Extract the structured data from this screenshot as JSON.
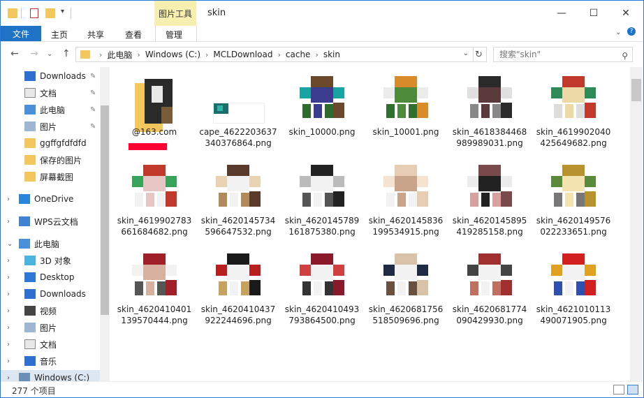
{
  "window": {
    "title": "skin",
    "context_tab": "图片工具",
    "close_glyph": "✕",
    "maximize_glyph": "☐",
    "minimize_glyph": "—"
  },
  "ribbon": {
    "file": "文件",
    "tabs": [
      "主页",
      "共享",
      "查看"
    ],
    "manage": "管理"
  },
  "address": {
    "crumbs": [
      "此电脑",
      "Windows (C:)",
      "MCLDownload",
      "cache",
      "skin"
    ],
    "search_placeholder": "搜索\"skin\""
  },
  "nav": {
    "items": [
      {
        "label": "Downloads",
        "icon": "download-arrow-icon",
        "pinned": true
      },
      {
        "label": "文档",
        "icon": "document-icon",
        "pinned": true
      },
      {
        "label": "此电脑",
        "icon": "computer-icon",
        "pinned": true
      },
      {
        "label": "图片",
        "icon": "pictures-icon",
        "pinned": true
      },
      {
        "label": "ggffgfdfdfd",
        "icon": "folder-icon",
        "pinned": false
      },
      {
        "label": "保存的图片",
        "icon": "folder-icon",
        "pinned": false
      },
      {
        "label": "屏幕截图",
        "icon": "folder-icon",
        "pinned": false
      },
      {
        "label": "OneDrive",
        "icon": "cloud-icon",
        "pinned": false
      },
      {
        "label": "WPS云文档",
        "icon": "wps-cloud-icon",
        "pinned": false
      },
      {
        "label": "此电脑",
        "icon": "computer-icon",
        "pinned": false
      },
      {
        "label": "3D 对象",
        "icon": "cube-icon",
        "pinned": false
      },
      {
        "label": "Desktop",
        "icon": "desktop-icon",
        "pinned": false
      },
      {
        "label": "Downloads",
        "icon": "download-arrow-icon",
        "pinned": false
      },
      {
        "label": "视频",
        "icon": "video-icon",
        "pinned": false
      },
      {
        "label": "图片",
        "icon": "pictures-icon",
        "pinned": false
      },
      {
        "label": "文档",
        "icon": "document-icon",
        "pinned": false
      },
      {
        "label": "音乐",
        "icon": "music-icon",
        "pinned": false
      },
      {
        "label": "Windows (C:)",
        "icon": "drive-icon",
        "pinned": false
      }
    ]
  },
  "files": [
    {
      "name": "@163.com"
    },
    {
      "name": "cape_4622203637340376864.png"
    },
    {
      "name": "skin_10000.png"
    },
    {
      "name": "skin_10001.png"
    },
    {
      "name": "skin_4618384468989989031.png"
    },
    {
      "name": "skin_4619902040425649682.png"
    },
    {
      "name": "skin_4619902783661684682.png"
    },
    {
      "name": "skin_4620145734596647532.png"
    },
    {
      "name": "skin_4620145789161875380.png"
    },
    {
      "name": "skin_4620145836199534915.png"
    },
    {
      "name": "skin_4620145895419285158.png"
    },
    {
      "name": "skin_4620149576022233651.png"
    },
    {
      "name": "skin_4620410401139570444.png"
    },
    {
      "name": "skin_4620410437922244696.png"
    },
    {
      "name": "skin_4620410493793864500.png"
    },
    {
      "name": "skin_4620681756518509696.png"
    },
    {
      "name": "skin_4620681774090429930.png"
    },
    {
      "name": "skin_4621010113490071905.png"
    }
  ],
  "status": {
    "count": "277 个项目"
  },
  "colors": {
    "accent": "#1e73c7",
    "context": "#f7efb0",
    "folder": "#f3c75d"
  }
}
